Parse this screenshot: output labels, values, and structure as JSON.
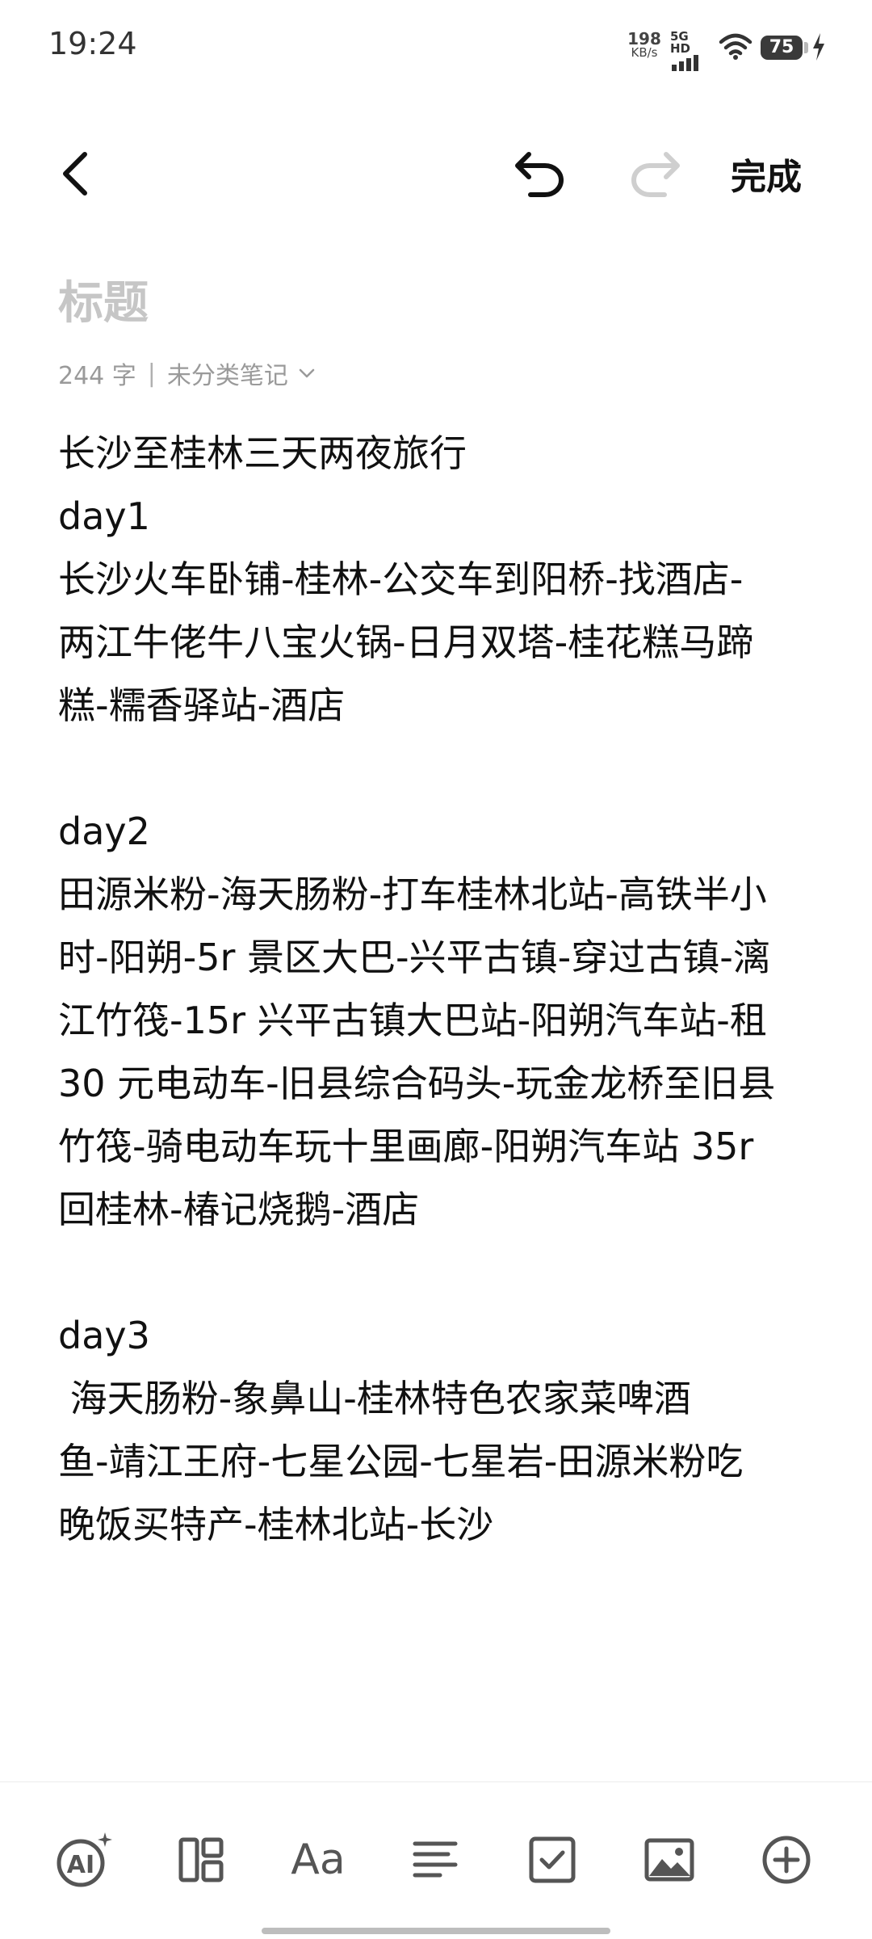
{
  "status_bar": {
    "time": "19:24",
    "net_speed": "198",
    "net_speed_unit": "KB/s",
    "network": "5G HD",
    "battery": "75"
  },
  "toolbar": {
    "done_label": "完成"
  },
  "note": {
    "title_placeholder": "标题",
    "word_count": "244 字",
    "separator": "|",
    "category": "未分类笔记",
    "lines": [
      "长沙至桂林三天两夜旅行",
      "day1",
      "长沙火车卧铺-桂林-公交车到阳桥-找酒店-",
      "两江牛佬牛八宝火锅-日月双塔-桂花糕马蹄",
      "糕-糯香驿站-酒店",
      "",
      "day2",
      "田源米粉-海天肠粉-打车桂林北站-高铁半小",
      "时-阳朔-5r 景区大巴-兴平古镇-穿过古镇-漓",
      "江竹筏-15r 兴平古镇大巴站-阳朔汽车站-租",
      "30 元电动车-旧县综合码头-玩金龙桥至旧县",
      "竹筏-骑电动车玩十里画廊-阳朔汽车站 35r",
      "回桂林-椿记烧鹅-酒店",
      "",
      "day3",
      " 海天肠粉-象鼻山-桂林特色农家菜啤酒",
      "鱼-靖江王府-七星公园-七星岩-田源米粉吃",
      "晚饭买特产-桂林北站-长沙"
    ]
  },
  "bottom_tools": {
    "ai_label": "AI",
    "font_label": "Aa"
  },
  "icons": [
    "back-icon",
    "undo-icon",
    "redo-icon",
    "chevron-down-icon",
    "ai-icon",
    "layout-icon",
    "font-icon",
    "align-icon",
    "checkbox-icon",
    "image-icon",
    "add-icon",
    "wifi-icon",
    "signal-icon",
    "charging-icon"
  ]
}
